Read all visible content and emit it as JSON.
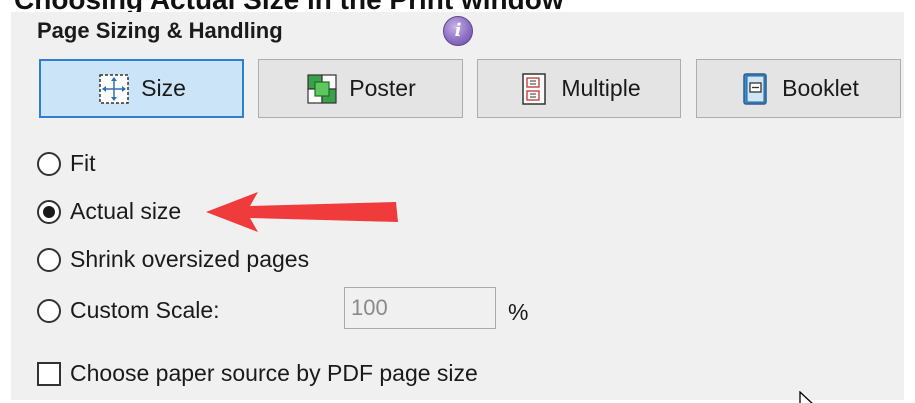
{
  "caption": "Choosing Actual Size in the Print window",
  "section": {
    "title": "Page Sizing & Handling",
    "info_icon": "info-icon"
  },
  "mode_buttons": [
    {
      "label": "Size",
      "icon": "size-icon",
      "active": true
    },
    {
      "label": "Poster",
      "icon": "poster-icon",
      "active": false
    },
    {
      "label": "Multiple",
      "icon": "multiple-icon",
      "active": false
    },
    {
      "label": "Booklet",
      "icon": "booklet-icon",
      "active": false
    }
  ],
  "options": {
    "fit": {
      "label": "Fit",
      "checked": false
    },
    "actual_size": {
      "label": "Actual size",
      "checked": true
    },
    "shrink": {
      "label": "Shrink oversized pages",
      "checked": false
    },
    "custom_scale": {
      "label": "Custom Scale:",
      "checked": false,
      "value": "100",
      "unit": "%"
    }
  },
  "paper_source": {
    "label": "Choose paper source by PDF page size",
    "checked": false
  },
  "colors": {
    "active_button_bg": "#cce4f7",
    "active_button_border": "#2f7fd1",
    "panel_bg": "#f0f0f0",
    "annotation_arrow": "#ef3b3b"
  }
}
